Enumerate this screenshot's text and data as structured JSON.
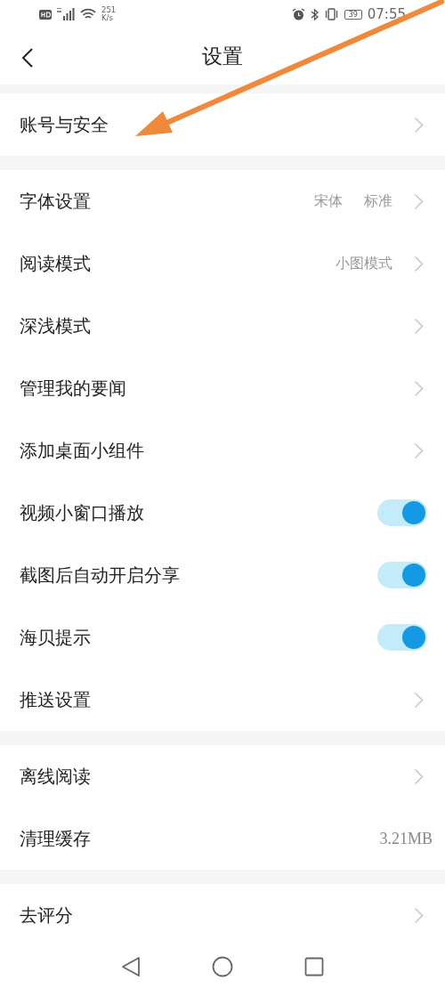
{
  "status_bar": {
    "network_speed": [
      "251",
      "K/s"
    ],
    "battery": "39",
    "time": "07:55"
  },
  "header": {
    "title": "设置"
  },
  "groups": [
    {
      "items": [
        {
          "kind": "link",
          "label": "账号与安全"
        }
      ]
    },
    {
      "items": [
        {
          "kind": "link",
          "label": "字体设置",
          "values": [
            "宋体",
            "标准"
          ]
        },
        {
          "kind": "link",
          "label": "阅读模式",
          "values": [
            "小图模式"
          ]
        },
        {
          "kind": "link",
          "label": "深浅模式"
        },
        {
          "kind": "link",
          "label": "管理我的要闻"
        },
        {
          "kind": "link",
          "label": "添加桌面小组件"
        },
        {
          "kind": "toggle",
          "label": "视频小窗口播放",
          "on": true
        },
        {
          "kind": "toggle",
          "label": "截图后自动开启分享",
          "on": true
        },
        {
          "kind": "toggle",
          "label": "海贝提示",
          "on": true
        },
        {
          "kind": "link",
          "label": "推送设置"
        }
      ]
    },
    {
      "items": [
        {
          "kind": "link",
          "label": "离线阅读"
        },
        {
          "kind": "value",
          "label": "清理缓存",
          "value": "3.21MB"
        }
      ]
    },
    {
      "items": [
        {
          "kind": "link",
          "label": "去评分"
        }
      ]
    }
  ],
  "annotation": {
    "kind": "arrow"
  }
}
